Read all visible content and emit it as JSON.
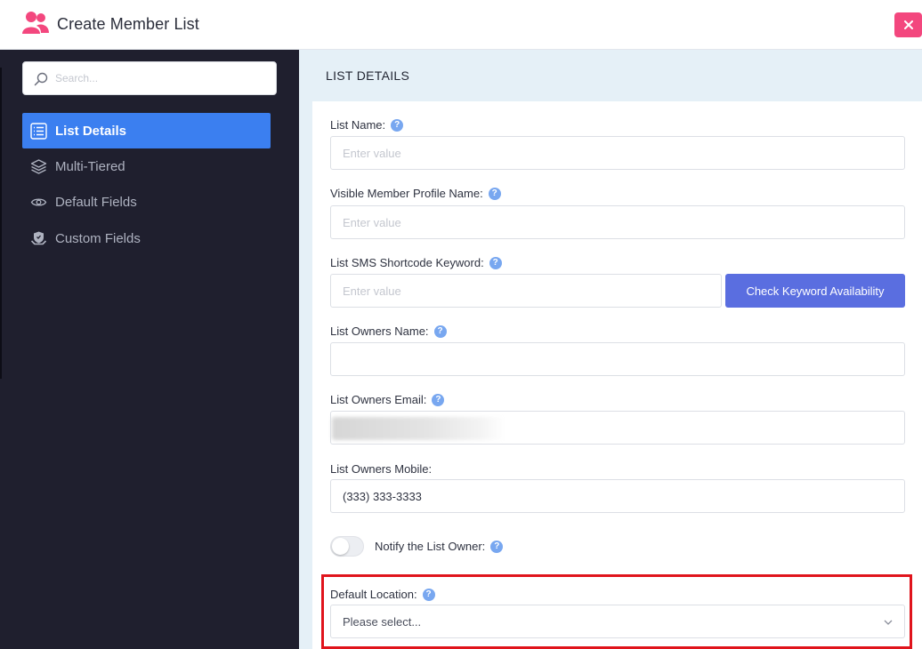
{
  "header": {
    "title": "Create Member List",
    "close_label": "×",
    "icon": "users-icon",
    "accent_color": "#f3477e"
  },
  "sidebar": {
    "search_placeholder": "Search...",
    "items": [
      {
        "label": "List Details",
        "icon": "list-icon",
        "active": true
      },
      {
        "label": "Multi-Tiered",
        "icon": "layers-icon",
        "active": false
      },
      {
        "label": "Default Fields",
        "icon": "eye-icon",
        "active": false
      },
      {
        "label": "Custom Fields",
        "icon": "hand-shield-icon",
        "active": false
      }
    ],
    "active_color": "#3b7ff0"
  },
  "main": {
    "section_title": "LIST DETAILS",
    "help_glyph": "?",
    "fields": {
      "list_name": {
        "label": "List Name:",
        "placeholder": "Enter value",
        "value": ""
      },
      "visible_name": {
        "label": "Visible Member Profile Name:",
        "placeholder": "Enter value",
        "value": ""
      },
      "sms_keyword": {
        "label": "List SMS Shortcode Keyword:",
        "placeholder": "Enter value",
        "value": "",
        "button_label": "Check Keyword Availability"
      },
      "owner_name": {
        "label": "List Owners Name:",
        "value": ""
      },
      "owner_email": {
        "label": "List Owners Email:",
        "value": ""
      },
      "owner_mobile": {
        "label": "List Owners Mobile:",
        "value": "(333) 333-3333"
      },
      "notify_owner": {
        "label": "Notify the List Owner:",
        "checked": false
      },
      "default_location": {
        "label": "Default Location:",
        "selected": "Please select..."
      }
    },
    "button_color": "#5a6ee0",
    "highlight_color": "#e0141c"
  }
}
